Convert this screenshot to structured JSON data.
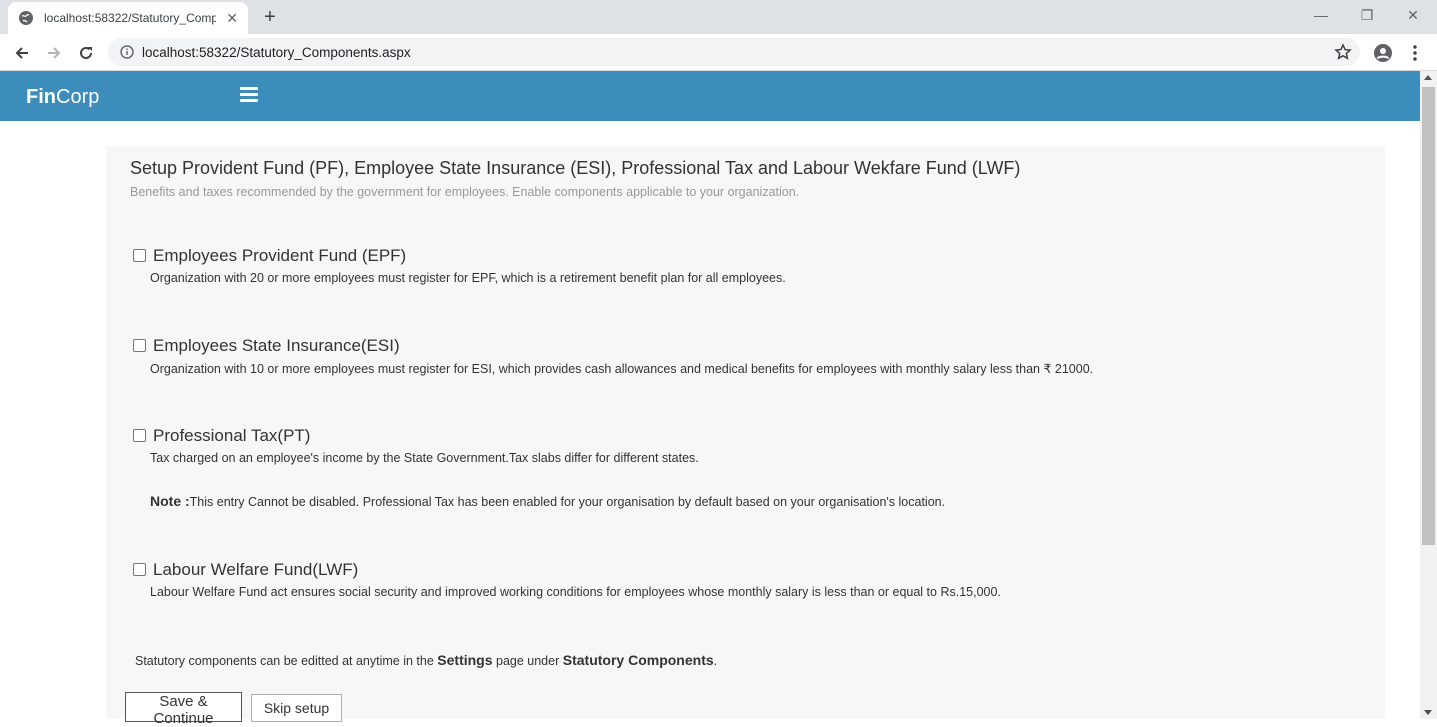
{
  "browser": {
    "tab_title": "localhost:58322/Statutory_Comp",
    "new_tab": "+",
    "url": "localhost:58322/Statutory_Components.aspx"
  },
  "app": {
    "brand_bold": "Fin",
    "brand_rest": "Corp",
    "accent_color": "#3c8dbc"
  },
  "page": {
    "title": "Setup Provident Fund (PF), Employee State Insurance (ESI), Professional Tax and Labour Wekfare Fund (LWF)",
    "subtitle": "Benefits and taxes recommended by the government for employees. Enable components applicable to your organization."
  },
  "components": [
    {
      "title": "Employees Provident Fund (EPF)",
      "description": "Organization with 20 or more employees must register for EPF, which is a retirement benefit plan for all employees.",
      "checked": false
    },
    {
      "title": "Employees State Insurance(ESI)",
      "description": "Organization with 10 or more employees must register for ESI, which provides cash allowances and medical benefits for employees with monthly salary less than ₹ 21000.",
      "checked": false
    },
    {
      "title": "Professional Tax(PT)",
      "description": "Tax charged on an employee's income by the State Government.Tax slabs differ for different states.",
      "checked": false
    },
    {
      "title": "Labour Welfare Fund(LWF)",
      "description": "Labour Welfare Fund act ensures social security and improved working conditions for employees whose monthly salary is less than or equal to Rs.15,000.",
      "checked": false
    }
  ],
  "note": {
    "label": "Note :",
    "text": "This entry Cannot be disabled. Professional Tax has been enabled for your organisation by default based on your organisation's location."
  },
  "footer": {
    "prefix": "Statutory components can be editted at anytime in the",
    "settings": "Settings",
    "middle": "page under",
    "components": "Statutory Components",
    "suffix": "."
  },
  "actions": {
    "save_label": "Save & Continue",
    "skip_label": "Skip setup"
  }
}
